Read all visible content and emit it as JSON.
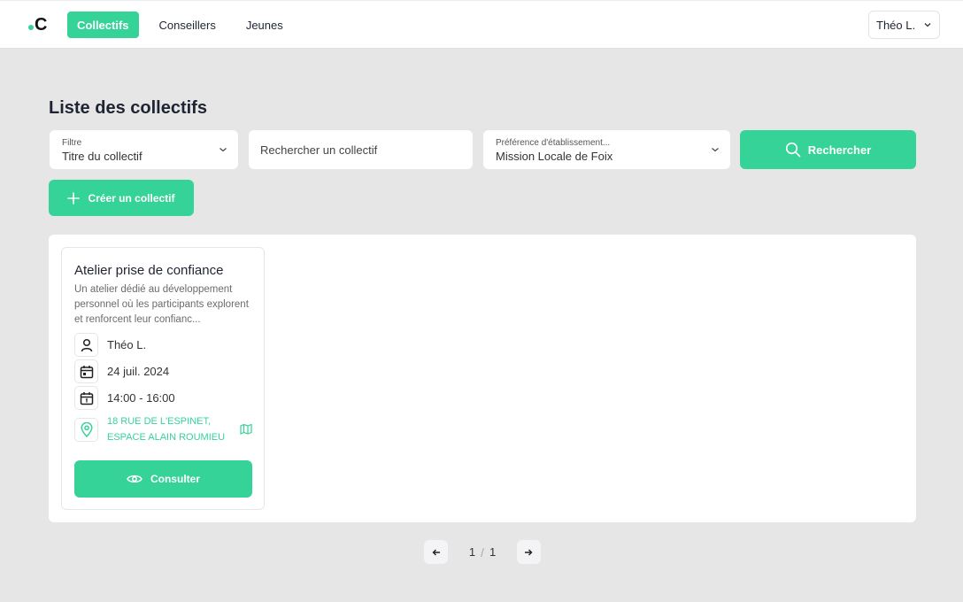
{
  "header": {
    "logo_text": "C",
    "nav": [
      {
        "label": "Collectifs",
        "active": true
      },
      {
        "label": "Conseillers",
        "active": false
      },
      {
        "label": "Jeunes",
        "active": false
      }
    ],
    "user_menu_label": "Théo L."
  },
  "main": {
    "title": "Liste des collectifs",
    "filter": {
      "label": "Filtre",
      "value": "Titre du collectif"
    },
    "search": {
      "placeholder": "Rechercher un collectif"
    },
    "establishment": {
      "label": "Préférence d'établissement...",
      "value": "Mission Locale de Foix"
    },
    "search_button": "Rechercher",
    "create_button": "Créer un collectif"
  },
  "cards": [
    {
      "title": "Atelier prise de confiance",
      "description": "Un atelier dédié au développement personnel où les participants explorent et renforcent leur confianc...",
      "advisor": "Théo L.",
      "date": "24 juil. 2024",
      "time": "14:00 - 16:00",
      "address": "18 RUE DE L'ESPINET, ESPACE ALAIN ROUMIEU",
      "consult_button": "Consulter"
    }
  ],
  "pagination": {
    "current": "1",
    "separator": "/",
    "total": "1"
  },
  "colors": {
    "accent": "#36d399",
    "background": "#e6e6e6",
    "text": "#1f2433"
  }
}
